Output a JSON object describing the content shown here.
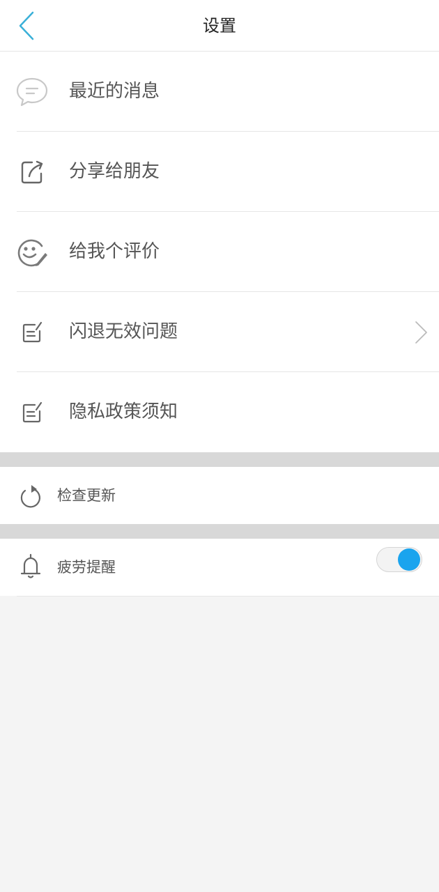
{
  "header": {
    "title": "设置"
  },
  "menu": {
    "items": [
      {
        "label": "最近的消息",
        "icon": "message-bubble-icon"
      },
      {
        "label": "分享给朋友",
        "icon": "share-icon"
      },
      {
        "label": "给我个评价",
        "icon": "rate-smiley-icon"
      },
      {
        "label": "闪退无效问题",
        "icon": "edit-note-icon",
        "has_chevron": true
      },
      {
        "label": "隐私政策须知",
        "icon": "edit-note-icon"
      }
    ]
  },
  "update": {
    "label": "检查更新",
    "icon": "refresh-icon"
  },
  "fatigue": {
    "label": "疲劳提醒",
    "icon": "bell-icon",
    "toggle_on": true
  },
  "colors": {
    "accent": "#1aa4ee",
    "back_arrow": "#3ab0d8",
    "text": "#555555",
    "separator": "#d8d8d8"
  }
}
